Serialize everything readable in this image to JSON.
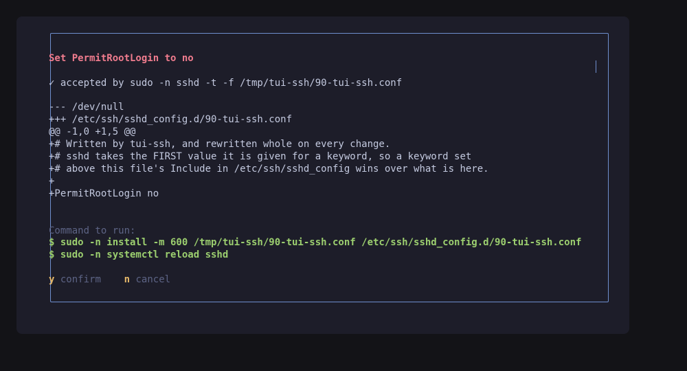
{
  "dialog": {
    "title": "Set PermitRootLogin to no",
    "validation": "✓ accepted by sudo -n sshd -t -f /tmp/tui-ssh/90-tui-ssh.conf",
    "diff_lines": [
      "--- /dev/null",
      "+++ /etc/ssh/sshd_config.d/90-tui-ssh.conf",
      "@@ -1,0 +1,5 @@",
      "+# Written by tui-ssh, and rewritten whole on every change.",
      "+# sshd takes the FIRST value it is given for a keyword, so a keyword set",
      "+# above this file's Include in /etc/ssh/sshd_config wins over what is here.",
      "+",
      "+PermitRootLogin no"
    ],
    "command_label": "Command to run:",
    "commands": [
      "$ sudo -n install -m 600 /tmp/tui-ssh/90-tui-ssh.conf /etc/ssh/sshd_config.d/90-tui-ssh.conf",
      "$ sudo -n systemctl reload sshd"
    ],
    "actions": {
      "confirm_key": "y",
      "confirm_label": "confirm",
      "cancel_key": "n",
      "cancel_label": "cancel"
    }
  },
  "colors": {
    "background": "#131317",
    "panel": "#1d1d29",
    "border": "#6f8fcf",
    "title": "#f07c8e",
    "text": "#c4cae0",
    "dim": "#5d6485",
    "command": "#9ccf6f",
    "key": "#e6b86a"
  }
}
